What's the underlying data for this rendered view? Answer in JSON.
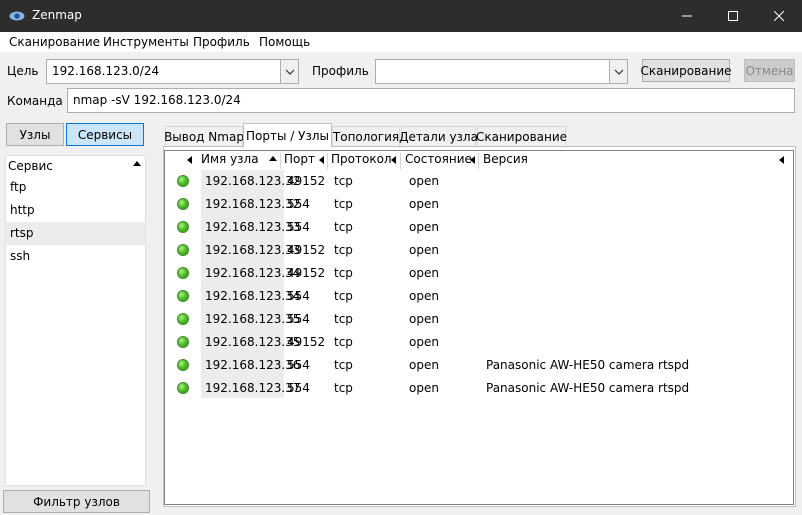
{
  "window": {
    "title": "Zenmap"
  },
  "menu": [
    "Сканирование",
    "Инструменты",
    "Профиль",
    "Помощь"
  ],
  "target": {
    "label": "Цель",
    "value": "192.168.123.0/24"
  },
  "profile": {
    "label": "Профиль",
    "value": ""
  },
  "buttons": {
    "scan": "Сканирование",
    "cancel": "Отмена"
  },
  "command": {
    "label": "Команда",
    "value": "nmap -sV 192.168.123.0/24"
  },
  "left_panel": {
    "hosts_btn": "Узлы",
    "services_btn": "Сервисы",
    "header": "Сервис",
    "services": [
      "ftp",
      "http",
      "rtsp",
      "ssh"
    ],
    "selected": "rtsp",
    "filter_btn": "Фильтр узлов"
  },
  "tabs": [
    "Вывод Nmap",
    "Порты / Узлы",
    "Топология",
    "Детали узла",
    "Сканирование"
  ],
  "active_tab": "Порты / Узлы",
  "table": {
    "columns": [
      "Имя узла",
      "Порт",
      "Протокол",
      "Состояние",
      "Версия"
    ],
    "rows": [
      {
        "host": "192.168.123.32",
        "port": "49152",
        "protocol": "tcp",
        "state": "open",
        "version": ""
      },
      {
        "host": "192.168.123.32",
        "port": "554",
        "protocol": "tcp",
        "state": "open",
        "version": ""
      },
      {
        "host": "192.168.123.33",
        "port": "554",
        "protocol": "tcp",
        "state": "open",
        "version": ""
      },
      {
        "host": "192.168.123.33",
        "port": "49152",
        "protocol": "tcp",
        "state": "open",
        "version": ""
      },
      {
        "host": "192.168.123.34",
        "port": "49152",
        "protocol": "tcp",
        "state": "open",
        "version": ""
      },
      {
        "host": "192.168.123.34",
        "port": "554",
        "protocol": "tcp",
        "state": "open",
        "version": ""
      },
      {
        "host": "192.168.123.35",
        "port": "554",
        "protocol": "tcp",
        "state": "open",
        "version": ""
      },
      {
        "host": "192.168.123.35",
        "port": "49152",
        "protocol": "tcp",
        "state": "open",
        "version": ""
      },
      {
        "host": "192.168.123.36",
        "port": "554",
        "protocol": "tcp",
        "state": "open",
        "version": "Panasonic AW-HE50 camera rtspd"
      },
      {
        "host": "192.168.123.37",
        "port": "554",
        "protocol": "tcp",
        "state": "open",
        "version": "Panasonic AW-HE50 camera rtspd"
      }
    ]
  },
  "colors": {
    "titlebar": "#2d2d2d",
    "accent": "#0078d7",
    "status_open": "#4fbf2a"
  }
}
